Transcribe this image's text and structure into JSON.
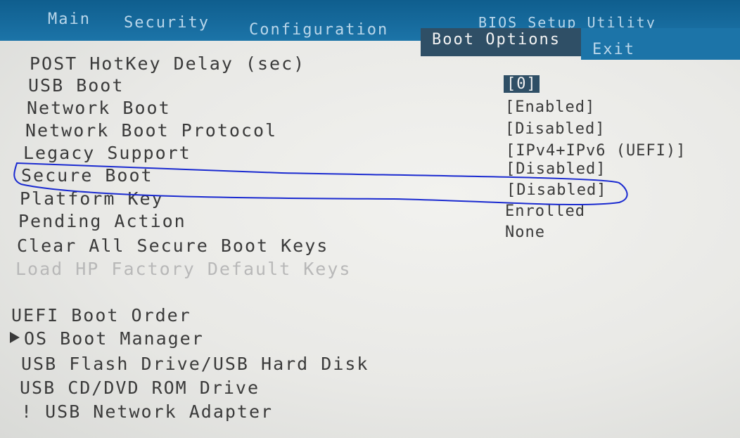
{
  "menu": {
    "tabs": {
      "main": "Main",
      "security": "Security",
      "configuration": "Configuration",
      "boot_options": "Boot Options",
      "exit": "Exit"
    },
    "utility_title": "BIOS Setup Utility"
  },
  "settings": {
    "post_hotkey_delay": {
      "label": "POST HotKey Delay (sec)",
      "value": "[0]"
    },
    "usb_boot": {
      "label": "USB Boot",
      "value": "[Enabled]"
    },
    "network_boot": {
      "label": "Network Boot",
      "value": "[Disabled]"
    },
    "network_boot_protocol": {
      "label": "Network Boot Protocol",
      "value": "[IPv4+IPv6 (UEFI)]"
    },
    "legacy_support": {
      "label": "Legacy Support",
      "value": "[Disabled]"
    },
    "secure_boot": {
      "label": "Secure Boot",
      "value": "[Disabled]"
    },
    "platform_key": {
      "label": "Platform Key",
      "value": "Enrolled"
    },
    "pending_action": {
      "label": "Pending Action",
      "value": "None"
    },
    "clear_all_secure_boot_keys": {
      "label": "Clear All Secure Boot Keys"
    },
    "load_hp_factory_default_keys": {
      "label": "Load HP Factory Default Keys"
    }
  },
  "boot_order": {
    "heading": "UEFI Boot Order",
    "items": [
      "OS Boot Manager",
      "USB Flash Drive/USB Hard Disk",
      "USB CD/DVD ROM Drive",
      "! USB Network Adapter"
    ]
  },
  "colors": {
    "menubar": "#1c74a8",
    "selected_bg": "#2f4f66",
    "annotation_stroke": "#1a2ad0"
  }
}
